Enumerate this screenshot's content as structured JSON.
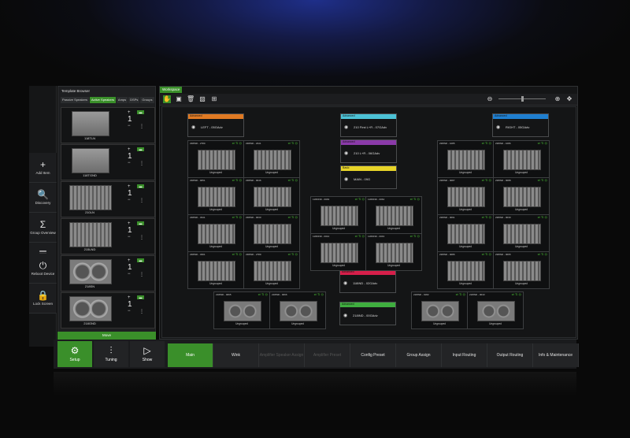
{
  "left_rail": {
    "items": [
      {
        "icon": "+",
        "label": "Add Item"
      },
      {
        "icon": "🔍",
        "label": "Discovery"
      },
      {
        "icon": "Σ",
        "label": "Group Overview"
      },
      {
        "icon": "☰",
        "label": "Summary"
      },
      {
        "icon": "⏻",
        "label": "Reboot Device"
      },
      {
        "icon": "🔒",
        "label": "Lock Screen"
      }
    ]
  },
  "template_browser": {
    "title": "Template Browser",
    "tabs": [
      "Passive Speakers",
      "Active Speakers",
      "Amps",
      "DSPs",
      "Groups"
    ],
    "speakers": [
      {
        "name": "118TLN",
        "qty": "1"
      },
      {
        "name": "118TGND",
        "qty": "1"
      },
      {
        "name": "210LN",
        "qty": "1"
      },
      {
        "name": "215LND",
        "qty": "1"
      },
      {
        "name": "218SN",
        "qty": "1"
      },
      {
        "name": "218GND",
        "qty": "1"
      }
    ],
    "move_label": "Move"
  },
  "workspace": {
    "title": "Workspace",
    "outputs": [
      {
        "tag": "Advanced",
        "text": "LEFT - 05GAdv",
        "color": "#e07a23"
      },
      {
        "tag": "Advanced",
        "text": "210 First L+R - 07GAdv",
        "color": "#4cc2d6"
      },
      {
        "tag": "Advanced",
        "text": "210 L+R - 06GAdv",
        "color": "#8a3aa8"
      },
      {
        "tag": "Basic",
        "text": "MAIN - 09G",
        "color": "#e8d428"
      },
      {
        "tag": "Advanced",
        "text": "RIGHT - 05GAdv",
        "color": "#1f7fd0"
      },
      {
        "tag": "Advanced",
        "text": "118IND - 02GAdv",
        "color": "#d61f4a"
      },
      {
        "tag": "Advanced",
        "text": "218IND - 00GAdv",
        "color": "#3fae3f"
      }
    ],
    "amp_ids": {
      "left": [
        "238IND - 2780",
        "238IND - 2341",
        "238IND - 0051",
        "238IND - 0046",
        "238IND - 3341",
        "238IND - 0030",
        "238IND - 3391",
        "238IND - 2789"
      ],
      "center": [
        "118FIND - 0049",
        "118FIND - 0064",
        "118FIND - 0044",
        "118FIND - 0043"
      ],
      "right": [
        "238IND - 1085",
        "238IND - 1086",
        "238IND - 0087",
        "238IND - 0088",
        "238IND - 0091",
        "238IND - 0039",
        "238IND - 0086",
        "238IND - 0065"
      ],
      "bottom_left": [
        "218IND - 0065",
        "218IND - 0066"
      ],
      "bottom_right": [
        "218IND - 0182",
        "218IND - 0043"
      ]
    },
    "ungrouped_label": "Ungrouped",
    "accent": "#3a8f2a"
  },
  "bottom_bar": {
    "left": [
      {
        "icon": "⚙",
        "label": "Setup"
      },
      {
        "icon": "⫶",
        "label": "Tuning"
      },
      {
        "icon": "▷",
        "label": "Show"
      }
    ],
    "modes": [
      "Main",
      "Wink",
      "Amplifier Speaker Assign",
      "Amplifier Preset",
      "Config Preset",
      "Group Assign",
      "Input Routing",
      "Output Routing",
      "Info & Maintenance"
    ]
  }
}
